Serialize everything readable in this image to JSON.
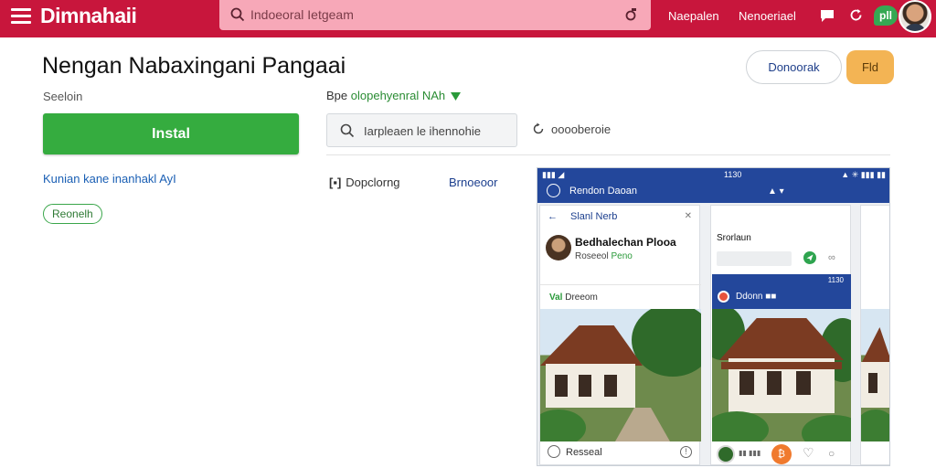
{
  "topbar": {
    "brand": "Dimnahaii",
    "search_text": "Indoeoral Ietgeam",
    "nav_links": [
      "Naepalen",
      "Nenoeriael"
    ],
    "badge": "pll",
    "colors": {
      "bar": "#c8163c",
      "search": "#f7a8b8"
    }
  },
  "header": {
    "title": "Nengan Nabaxingani Pangaai",
    "outline_button": "Donoorak",
    "orange_button": "Fld"
  },
  "left": {
    "seller": "Seeloin",
    "install_label": "Instal",
    "link": "Kunian kane inanhakl AyI",
    "chip": "Reonelh"
  },
  "middle": {
    "dev_prefix": "Bpe",
    "dev_name": "olopehyenral NAh",
    "search_text": "Iarpleaen le ihennohie",
    "share_text": "ooooberoie",
    "tabs": [
      "Dopclorng",
      "Brnoeoor"
    ]
  },
  "preview": {
    "status_left": "▮▮▮ ◢",
    "status_time": "1130",
    "status_right": "▲ ✳ ▮▮▮ ▮▮",
    "title": "Rendon Daoan",
    "card1": {
      "back": "←",
      "header": "Slanl Nerb",
      "close": "✕",
      "name": "Bedhalechan Plooa",
      "sub_prefix": "Roseeol",
      "sub_green": "Peno",
      "label_green": "Val",
      "label": "Dreeom",
      "footer": "Resseal",
      "info": "!"
    },
    "card2": {
      "title": "Srorlaun",
      "status_time": "1130",
      "bar_title": "Ddonn",
      "bar_tag": "■■",
      "footer_text": "▮▮ ▮▮▮",
      "badge": "₿",
      "heart": "♡",
      "chat": "○"
    }
  }
}
